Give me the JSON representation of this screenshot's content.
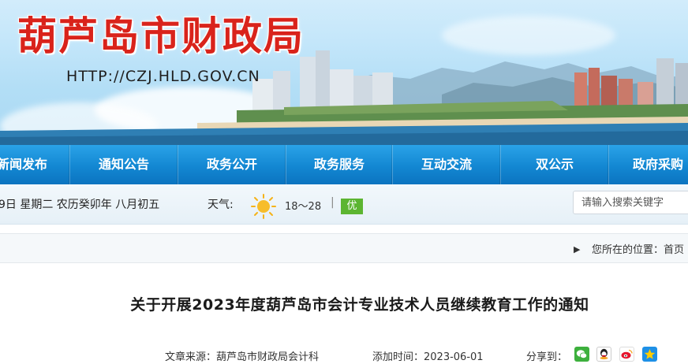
{
  "banner": {
    "site_title": "葫芦岛市财政局",
    "url": "HTTP://CZJ.HLD.GOV.CN"
  },
  "nav": {
    "items": [
      {
        "label": "新闻发布"
      },
      {
        "label": "通知公告"
      },
      {
        "label": "政务公开"
      },
      {
        "label": "政务服务"
      },
      {
        "label": "互动交流"
      },
      {
        "label": "双公示"
      },
      {
        "label": "政府采购"
      }
    ]
  },
  "infobar": {
    "date": "9日 星期二 农历癸卯年 八月初五",
    "weather_label": "天气:",
    "weather_icon": "sun-icon",
    "temperature": "18～28",
    "separator": "|",
    "air_quality": "优",
    "air_quality_color": "#5cb531",
    "search_placeholder": "请输入搜索关键字"
  },
  "location": {
    "icon": "triangle-right-icon",
    "label": "您所在的位置：首页"
  },
  "article": {
    "title": "关于开展2023年度葫芦岛市会计专业技术人员继续教育工作的通知",
    "source": "文章来源：葫芦岛市财政局会计科",
    "added_time": "添加时间：2023-06-01",
    "share_label": "分享到：",
    "share_icons": [
      "wechat-icon",
      "qq-icon",
      "weibo-icon",
      "qzone-icon"
    ]
  },
  "colors": {
    "title_red": "#d9231b",
    "nav_blue": "#1387d2"
  }
}
